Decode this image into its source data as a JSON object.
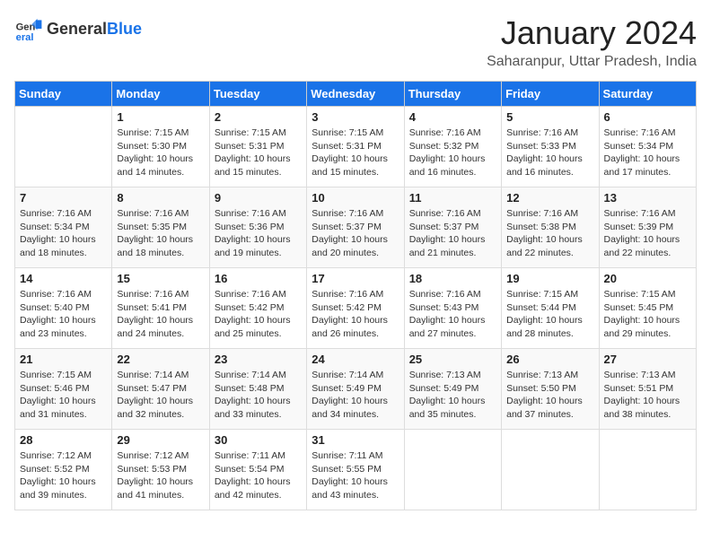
{
  "header": {
    "logo_general": "General",
    "logo_blue": "Blue",
    "month_title": "January 2024",
    "location": "Saharanpur, Uttar Pradesh, India"
  },
  "days_of_week": [
    "Sunday",
    "Monday",
    "Tuesday",
    "Wednesday",
    "Thursday",
    "Friday",
    "Saturday"
  ],
  "weeks": [
    [
      {
        "day": "",
        "info": ""
      },
      {
        "day": "1",
        "info": "Sunrise: 7:15 AM\nSunset: 5:30 PM\nDaylight: 10 hours\nand 14 minutes."
      },
      {
        "day": "2",
        "info": "Sunrise: 7:15 AM\nSunset: 5:31 PM\nDaylight: 10 hours\nand 15 minutes."
      },
      {
        "day": "3",
        "info": "Sunrise: 7:15 AM\nSunset: 5:31 PM\nDaylight: 10 hours\nand 15 minutes."
      },
      {
        "day": "4",
        "info": "Sunrise: 7:16 AM\nSunset: 5:32 PM\nDaylight: 10 hours\nand 16 minutes."
      },
      {
        "day": "5",
        "info": "Sunrise: 7:16 AM\nSunset: 5:33 PM\nDaylight: 10 hours\nand 16 minutes."
      },
      {
        "day": "6",
        "info": "Sunrise: 7:16 AM\nSunset: 5:34 PM\nDaylight: 10 hours\nand 17 minutes."
      }
    ],
    [
      {
        "day": "7",
        "info": "Sunrise: 7:16 AM\nSunset: 5:34 PM\nDaylight: 10 hours\nand 18 minutes."
      },
      {
        "day": "8",
        "info": "Sunrise: 7:16 AM\nSunset: 5:35 PM\nDaylight: 10 hours\nand 18 minutes."
      },
      {
        "day": "9",
        "info": "Sunrise: 7:16 AM\nSunset: 5:36 PM\nDaylight: 10 hours\nand 19 minutes."
      },
      {
        "day": "10",
        "info": "Sunrise: 7:16 AM\nSunset: 5:37 PM\nDaylight: 10 hours\nand 20 minutes."
      },
      {
        "day": "11",
        "info": "Sunrise: 7:16 AM\nSunset: 5:37 PM\nDaylight: 10 hours\nand 21 minutes."
      },
      {
        "day": "12",
        "info": "Sunrise: 7:16 AM\nSunset: 5:38 PM\nDaylight: 10 hours\nand 22 minutes."
      },
      {
        "day": "13",
        "info": "Sunrise: 7:16 AM\nSunset: 5:39 PM\nDaylight: 10 hours\nand 22 minutes."
      }
    ],
    [
      {
        "day": "14",
        "info": "Sunrise: 7:16 AM\nSunset: 5:40 PM\nDaylight: 10 hours\nand 23 minutes."
      },
      {
        "day": "15",
        "info": "Sunrise: 7:16 AM\nSunset: 5:41 PM\nDaylight: 10 hours\nand 24 minutes."
      },
      {
        "day": "16",
        "info": "Sunrise: 7:16 AM\nSunset: 5:42 PM\nDaylight: 10 hours\nand 25 minutes."
      },
      {
        "day": "17",
        "info": "Sunrise: 7:16 AM\nSunset: 5:42 PM\nDaylight: 10 hours\nand 26 minutes."
      },
      {
        "day": "18",
        "info": "Sunrise: 7:16 AM\nSunset: 5:43 PM\nDaylight: 10 hours\nand 27 minutes."
      },
      {
        "day": "19",
        "info": "Sunrise: 7:15 AM\nSunset: 5:44 PM\nDaylight: 10 hours\nand 28 minutes."
      },
      {
        "day": "20",
        "info": "Sunrise: 7:15 AM\nSunset: 5:45 PM\nDaylight: 10 hours\nand 29 minutes."
      }
    ],
    [
      {
        "day": "21",
        "info": "Sunrise: 7:15 AM\nSunset: 5:46 PM\nDaylight: 10 hours\nand 31 minutes."
      },
      {
        "day": "22",
        "info": "Sunrise: 7:14 AM\nSunset: 5:47 PM\nDaylight: 10 hours\nand 32 minutes."
      },
      {
        "day": "23",
        "info": "Sunrise: 7:14 AM\nSunset: 5:48 PM\nDaylight: 10 hours\nand 33 minutes."
      },
      {
        "day": "24",
        "info": "Sunrise: 7:14 AM\nSunset: 5:49 PM\nDaylight: 10 hours\nand 34 minutes."
      },
      {
        "day": "25",
        "info": "Sunrise: 7:13 AM\nSunset: 5:49 PM\nDaylight: 10 hours\nand 35 minutes."
      },
      {
        "day": "26",
        "info": "Sunrise: 7:13 AM\nSunset: 5:50 PM\nDaylight: 10 hours\nand 37 minutes."
      },
      {
        "day": "27",
        "info": "Sunrise: 7:13 AM\nSunset: 5:51 PM\nDaylight: 10 hours\nand 38 minutes."
      }
    ],
    [
      {
        "day": "28",
        "info": "Sunrise: 7:12 AM\nSunset: 5:52 PM\nDaylight: 10 hours\nand 39 minutes."
      },
      {
        "day": "29",
        "info": "Sunrise: 7:12 AM\nSunset: 5:53 PM\nDaylight: 10 hours\nand 41 minutes."
      },
      {
        "day": "30",
        "info": "Sunrise: 7:11 AM\nSunset: 5:54 PM\nDaylight: 10 hours\nand 42 minutes."
      },
      {
        "day": "31",
        "info": "Sunrise: 7:11 AM\nSunset: 5:55 PM\nDaylight: 10 hours\nand 43 minutes."
      },
      {
        "day": "",
        "info": ""
      },
      {
        "day": "",
        "info": ""
      },
      {
        "day": "",
        "info": ""
      }
    ]
  ]
}
